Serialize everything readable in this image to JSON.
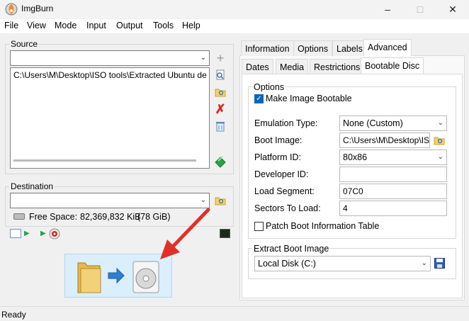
{
  "window": {
    "title": "ImgBurn"
  },
  "menu": [
    "File",
    "View",
    "Mode",
    "Input",
    "Output",
    "Tools",
    "Help"
  ],
  "source": {
    "label": "Source",
    "combo_value": "",
    "list_items": [
      "C:\\Users\\M\\Desktop\\ISO tools\\Extracted Ubuntu de"
    ]
  },
  "destination": {
    "label": "Destination",
    "combo_value": "",
    "free_space_label": "Free Space:",
    "free_space_value": "82,369,832 KiB",
    "free_space_gib": "(78 GiB)"
  },
  "tabs_top": [
    "Information",
    "Options",
    "Labels",
    "Advanced"
  ],
  "tabs_bottom": [
    "Dates",
    "Media",
    "Restrictions",
    "Bootable Disc"
  ],
  "options": {
    "label": "Options",
    "make_bootable_label": "Make Image Bootable",
    "make_bootable_checked": true,
    "emulation_type_label": "Emulation Type:",
    "emulation_type_value": "None (Custom)",
    "boot_image_label": "Boot Image:",
    "boot_image_value": "C:\\Users\\M\\Desktop\\IS",
    "platform_id_label": "Platform ID:",
    "platform_id_value": "80x86",
    "developer_id_label": "Developer ID:",
    "developer_id_value": "",
    "load_segment_label": "Load Segment:",
    "load_segment_value": "07C0",
    "sectors_to_load_label": "Sectors To Load:",
    "sectors_to_load_value": "4",
    "patch_boot_label": "Patch Boot Information Table",
    "patch_boot_checked": false
  },
  "extract": {
    "label": "Extract Boot Image",
    "drive_value": "Local Disk (C:)"
  },
  "status": {
    "text": "Ready"
  },
  "colors": {
    "accent": "#0067c0",
    "arrow_red": "#e0302a",
    "build_bg": "#dbeefb"
  }
}
